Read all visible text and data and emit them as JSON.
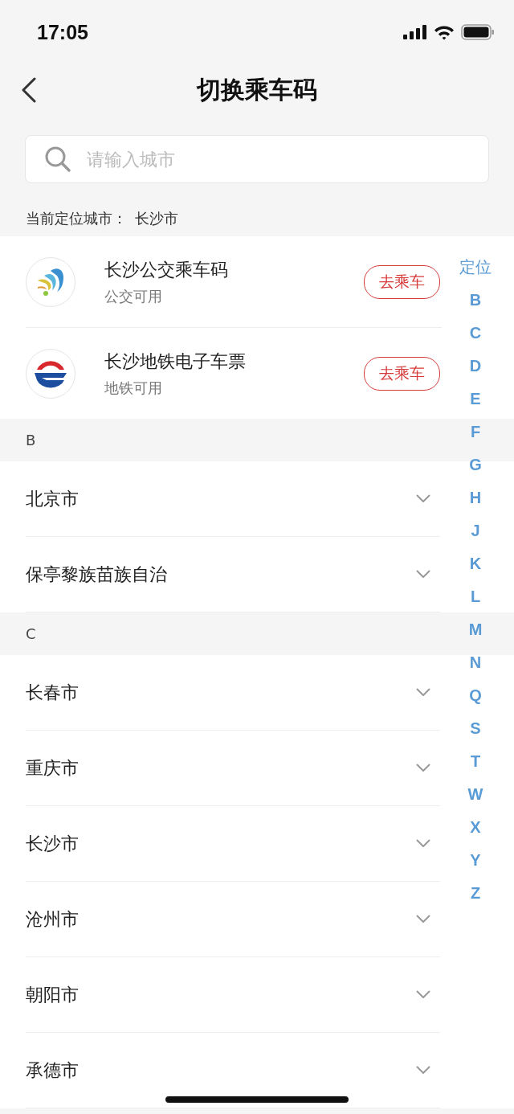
{
  "status_bar": {
    "time": "17:05"
  },
  "nav": {
    "title": "切换乘车码"
  },
  "search": {
    "placeholder": "请输入城市"
  },
  "current_city": {
    "label": "当前定位城市：",
    "city": "长沙市"
  },
  "services": [
    {
      "kind": "bus",
      "name": "长沙公交乘车码",
      "note": "公交可用",
      "button": "去乘车"
    },
    {
      "kind": "metro",
      "name": "长沙地铁电子车票",
      "note": "地铁可用",
      "button": "去乘车"
    }
  ],
  "sections": [
    {
      "letter": "B",
      "cities": [
        "北京市",
        "保亭黎族苗族自治"
      ]
    },
    {
      "letter": "C",
      "cities": [
        "长春市",
        "重庆市",
        "长沙市",
        "沧州市",
        "朝阳市",
        "承德市"
      ]
    }
  ],
  "index": [
    "定位",
    "B",
    "C",
    "D",
    "E",
    "F",
    "G",
    "H",
    "J",
    "K",
    "L",
    "M",
    "N",
    "Q",
    "S",
    "T",
    "W",
    "X",
    "Y",
    "Z"
  ]
}
